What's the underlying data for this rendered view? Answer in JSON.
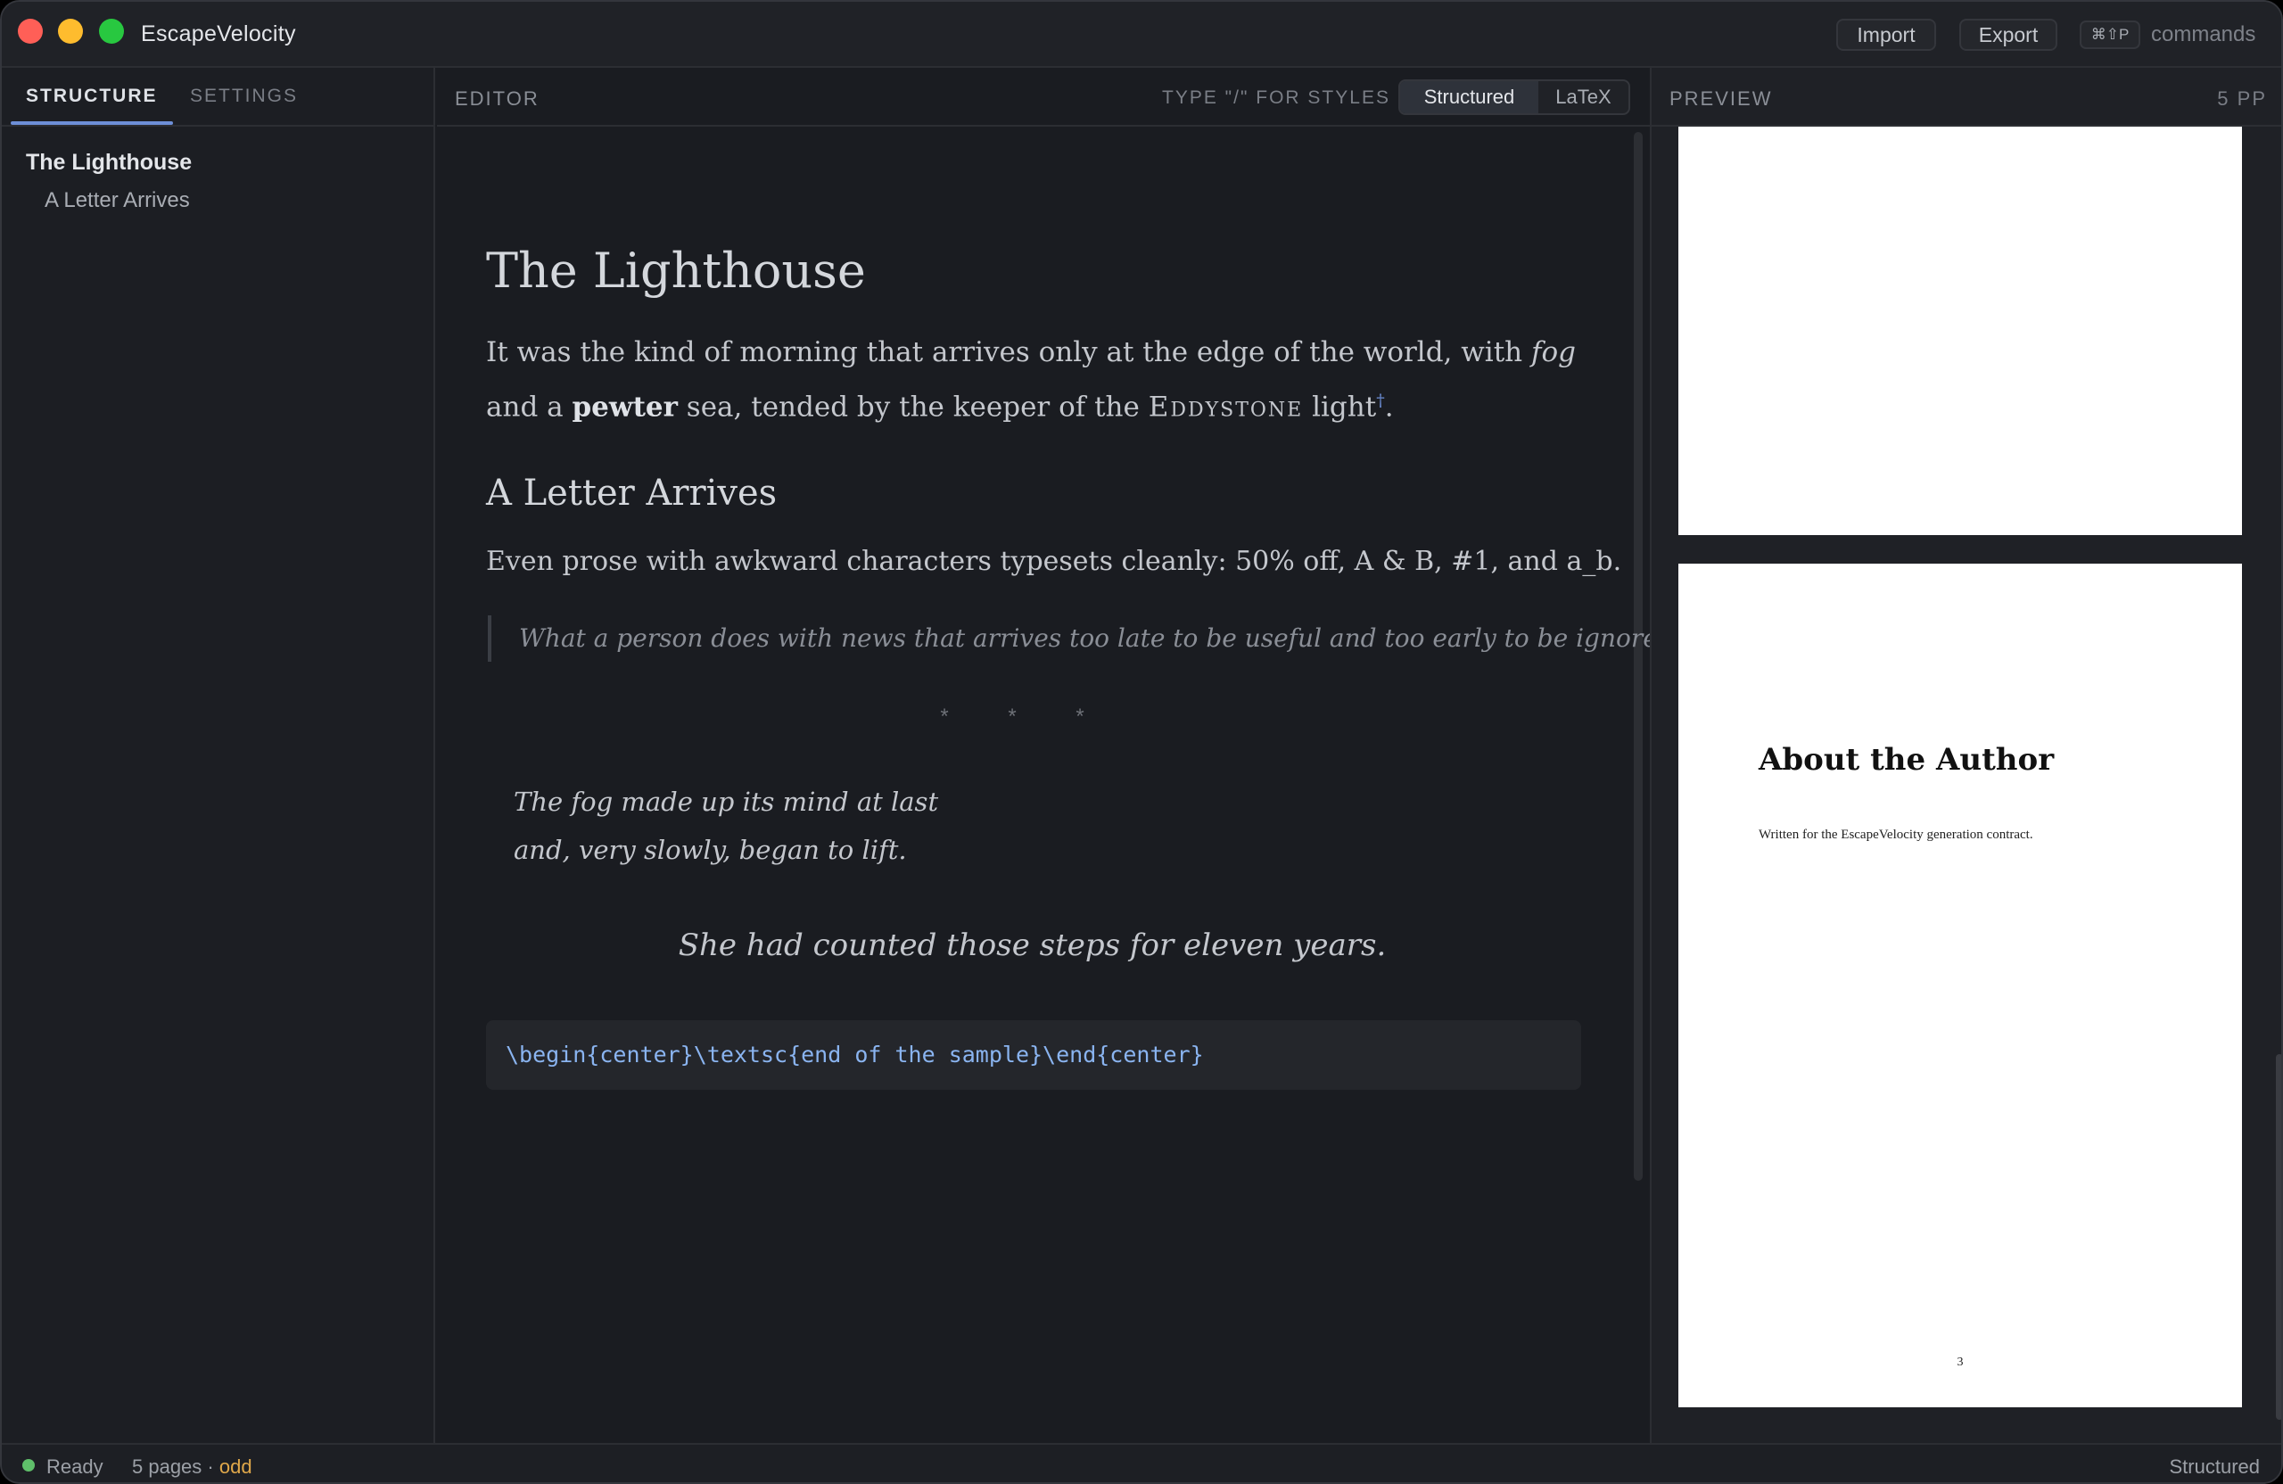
{
  "app": {
    "title": "EscapeVelocity"
  },
  "toolbar": {
    "import_label": "Import",
    "export_label": "Export",
    "shortcut": "⌘⇧P",
    "commands_label": "commands"
  },
  "sidebar": {
    "tabs": [
      {
        "label": "STRUCTURE",
        "active": true
      },
      {
        "label": "SETTINGS",
        "active": false
      }
    ],
    "outline": [
      {
        "level": 1,
        "label": "The Lighthouse"
      },
      {
        "level": 2,
        "label": "A Letter Arrives"
      }
    ]
  },
  "editor": {
    "label": "EDITOR",
    "hint": "TYPE \"/\" FOR STYLES",
    "modes": [
      {
        "label": "Structured",
        "active": true
      },
      {
        "label": "LaTeX",
        "active": false
      }
    ],
    "doc": {
      "h1": "The Lighthouse",
      "p1_a": "It was the kind of morning that arrives only at the edge of the world, with ",
      "p1_fog": "fog",
      "p1_b": " and a ",
      "p1_pewter": "pewter",
      "p1_c": " sea, tended by the keeper of the ",
      "p1_eddystone": "Eddystone",
      "p1_d": " light",
      "p1_fn": "†",
      "p1_e": ".",
      "h2": "A Letter Arrives",
      "p2": "Even prose with awkward characters typesets cleanly: 50% off, A & B, #1, and a_b.",
      "quote": "What a person does with news that arrives too late to be useful and too early to be ignored.",
      "scene_break": "* * *",
      "verse_1": "The fog made up its mind at last",
      "verse_2": "and, very slowly, began to lift.",
      "centered": "She had counted those steps for eleven years.",
      "code": "\\begin{center}\\textsc{end of the sample}\\end{center}"
    }
  },
  "preview": {
    "label": "PREVIEW",
    "page_count": "5 PP",
    "page": {
      "title": "About the Author",
      "text": "Written for the EscapeVelocity generation contract.",
      "number": "3"
    }
  },
  "status": {
    "ready": "Ready",
    "pages": "5 pages · ",
    "parity": "odd",
    "mode": "Structured",
    "ready_color": "#5fbf6a"
  }
}
